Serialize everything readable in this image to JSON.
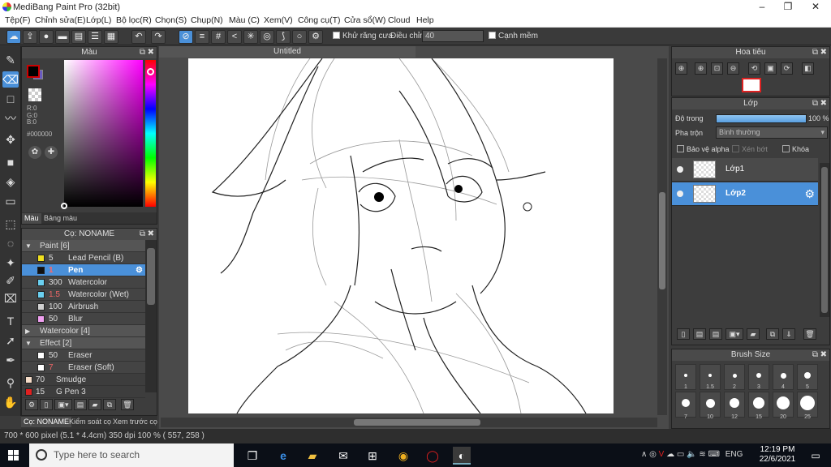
{
  "window": {
    "title": "MediBang Paint Pro (32bit)",
    "minimize": "–",
    "maximize": "❐",
    "close": "✕"
  },
  "menu": [
    "Tệp(F)",
    "Chỉnh sửa(E)",
    "Lớp(L)",
    "Bộ lọc(R)",
    "Chọn(S)",
    "Chụp(N)",
    "Màu (C)",
    "Xem(V)",
    "Công cụ(T)",
    "Cửa sổ(W)",
    "Cloud",
    "Help"
  ],
  "toolbar": {
    "antialias_label": "Khử răng cưa",
    "adjust_label": "Điều chỉnh",
    "adjust_value": "40",
    "smooth_label": "Cạnh mềm"
  },
  "color_panel": {
    "title": "Màu",
    "rgb": "R:0\nG:0\nB:0",
    "hex": "#000000",
    "tab_color": "Màu",
    "tab_palette": "Bảng màu",
    "fg_color": "#000000",
    "bg_color": "#6a5ac0"
  },
  "brush_panel": {
    "title": "Cọ: NONAME",
    "rows": [
      {
        "type": "group",
        "label": "Paint [6]",
        "arrow": "▼"
      },
      {
        "type": "brush",
        "color": "#f0e020",
        "size": "5",
        "name": "Lead Pencil (B)"
      },
      {
        "type": "brush",
        "color": "#111111",
        "size": "1",
        "name": "Pen",
        "selected": true
      },
      {
        "type": "brush",
        "color": "#6ad0f0",
        "size": "300",
        "name": "Watercolor"
      },
      {
        "type": "brush",
        "color": "#6ad0f0",
        "size": "1.5",
        "name": "Watercolor (Wet)"
      },
      {
        "type": "brush",
        "color": "#d0d0d0",
        "size": "100",
        "name": "Airbrush"
      },
      {
        "type": "brush",
        "color": "#f0a0f0",
        "size": "50",
        "name": "Blur"
      },
      {
        "type": "group",
        "label": "Watercolor [4]",
        "arrow": "▶"
      },
      {
        "type": "group",
        "label": "Effect [2]",
        "arrow": "▼"
      },
      {
        "type": "brush",
        "color": "#ffffff",
        "size": "50",
        "name": "Eraser"
      },
      {
        "type": "brush",
        "color": "#ffffff",
        "size": "7",
        "name": "Eraser (Soft)"
      },
      {
        "type": "brush-flat",
        "color": "#f5dcc8",
        "size": "70",
        "name": "Smudge"
      },
      {
        "type": "brush-flat",
        "color": "#e02020",
        "size": "15",
        "name": "G Pen 3"
      }
    ]
  },
  "left_tabs": [
    "Cọ: NONAME",
    "Kiểm soát cọ",
    "Xem trước cọ"
  ],
  "document": {
    "tab": "Untitled"
  },
  "navigator": {
    "title": "Hoa tiêu"
  },
  "layer_panel": {
    "title": "Lớp",
    "opacity_label": "Độ trong",
    "opacity_value": "100 %",
    "blend_label": "Pha trộn",
    "blend_value": "Bình thường",
    "protect_alpha": "Bảo vệ alpha",
    "clip": "Xén bớt",
    "lock": "Khóa",
    "layers": [
      {
        "name": "Lớp1",
        "selected": false
      },
      {
        "name": "Lớp2",
        "selected": true
      }
    ]
  },
  "brush_size_panel": {
    "title": "Brush Size",
    "row1": [
      "1",
      "1.5",
      "2",
      "3",
      "4",
      "5"
    ],
    "row2": [
      "7",
      "10",
      "12",
      "15",
      "20",
      "25"
    ]
  },
  "status": "700 * 600 pixel  (5.1 * 4.4cm)  350 dpi  100 %  ( 557, 258 )",
  "taskbar": {
    "search_placeholder": "Type here to search",
    "lang": "ENG",
    "time": "12:19 PM",
    "date": "22/6/2021"
  }
}
